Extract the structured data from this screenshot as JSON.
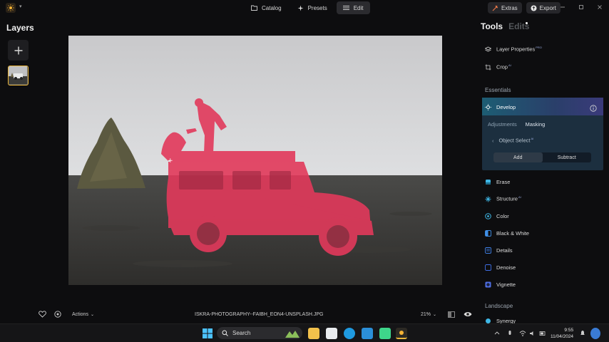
{
  "titlebar": {
    "tabs": [
      {
        "label": "Catalog",
        "icon": "folder-icon"
      },
      {
        "label": "Presets",
        "icon": "presets-icon"
      },
      {
        "label": "Edit",
        "icon": "sliders-icon",
        "active": true
      }
    ],
    "extras_label": "Extras",
    "export_label": "Export"
  },
  "layers": {
    "title": "Layers"
  },
  "bottombar": {
    "actions_label": "Actions",
    "filename": "ISKRA-PHOTOGRAPHY--FAIBH_EON4-UNSPLASH.JPG",
    "zoom": "21%"
  },
  "rightpanel": {
    "tabs": [
      {
        "label": "Tools",
        "active": true
      },
      {
        "label": "Edits",
        "active": false
      }
    ],
    "top_tools": [
      {
        "label": "Layer Properties",
        "badge": "PRO",
        "icon": "layers-icon"
      },
      {
        "label": "Crop",
        "badge": "AI",
        "icon": "crop-icon"
      }
    ],
    "essentials_label": "Essentials",
    "develop_label": "Develop",
    "develop_tabs": [
      "Adjustments",
      "Masking"
    ],
    "object_select_label": "Object Select",
    "object_select_badge": "AI",
    "mask_modes": [
      "Add",
      "Subtract"
    ],
    "tools": [
      {
        "label": "Erase",
        "icon": "erase-icon",
        "color": "#3fb7e6"
      },
      {
        "label": "Structure",
        "badge": "AI",
        "icon": "structure-icon",
        "color": "#3fb7e6"
      },
      {
        "label": "Color",
        "icon": "color-icon",
        "color": "#3fb7e6"
      },
      {
        "label": "Black & White",
        "icon": "bw-icon",
        "color": "#3f8fe6"
      },
      {
        "label": "Details",
        "icon": "details-icon",
        "color": "#3f7fe6"
      },
      {
        "label": "Denoise",
        "icon": "denoise-icon",
        "color": "#3f6fe6"
      },
      {
        "label": "Vignette",
        "icon": "vignette-icon",
        "color": "#4f6fe6"
      }
    ],
    "landscape_label": "Landscape",
    "partial_tool_label": "Synergy"
  },
  "taskbar": {
    "search_placeholder": "Search",
    "time": "9:55",
    "date": "11/04/2024"
  },
  "colors": {
    "accent": "#e9b53a",
    "develop_gradient_start": "#1d5d73",
    "mask": "#e8395a"
  }
}
